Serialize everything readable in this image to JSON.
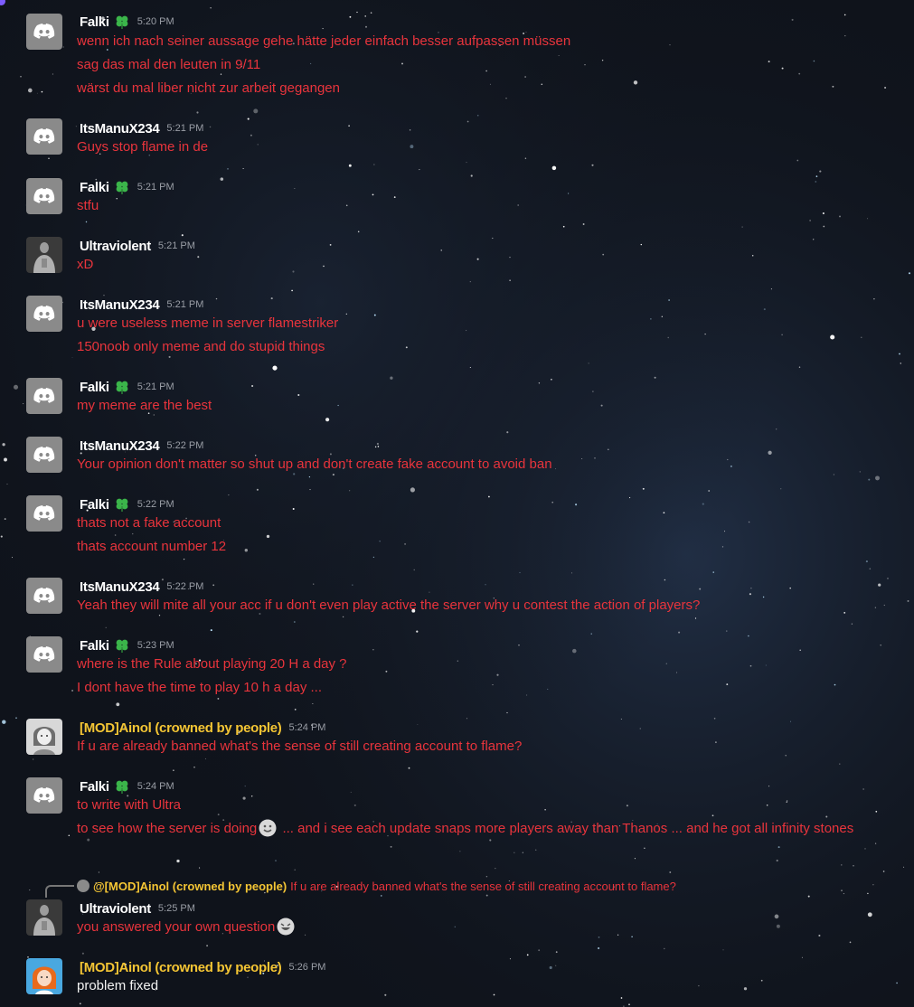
{
  "window": {
    "title": ""
  },
  "icons": {
    "default_avatar": "discord-logo-icon",
    "badge": "green-clover-badge-icon",
    "emoji_smile": "slight-smile-emoji-icon",
    "emoji_laugh": "rofl-emoji-icon"
  },
  "colors": {
    "message_text": "#e8343c",
    "username": "#ffffff",
    "mod_username": "#f4c534",
    "timestamp": "#9a9ea6",
    "badge": "#3bb54a",
    "avatar_bg": "#8a8a8a",
    "background": "#10141c"
  },
  "messages": [
    {
      "author": "Falki",
      "time": "5:20 PM",
      "lines": [
        "wenn ich nach seiner aussage gehe hätte jeder einfach besser aufpassen müssen",
        "sag das mal den leuten in 9/11",
        "wärst du mal liber nicht zur arbeit gegangen"
      ]
    },
    {
      "author": "ItsManuX234",
      "time": "5:21 PM",
      "lines": [
        "Guys stop flame in de"
      ]
    },
    {
      "author": "Falki",
      "time": "5:21 PM",
      "lines": [
        "stfu"
      ]
    },
    {
      "author": "Ultraviolent",
      "time": "5:21 PM",
      "lines": [
        "xD"
      ]
    },
    {
      "author": "ItsManuX234",
      "time": "5:21 PM",
      "lines": [
        "u were useless meme in server flamestriker",
        "150noob only meme and do stupid things"
      ]
    },
    {
      "author": "Falki",
      "time": "5:21 PM",
      "lines": [
        "my meme are the best"
      ]
    },
    {
      "author": "ItsManuX234",
      "time": "5:22 PM",
      "lines": [
        "Your opinion don't matter so shut up and don't create fake account to avoid ban"
      ]
    },
    {
      "author": "Falki",
      "time": "5:22 PM",
      "lines": [
        "thats not a fake account",
        "thats account number 12"
      ]
    },
    {
      "author": "ItsManuX234",
      "time": "5:22 PM",
      "lines": [
        "Yeah they will mite all your acc if u don't even play active the server why u contest the action of players?"
      ]
    },
    {
      "author": "Falki",
      "time": "5:23 PM",
      "lines": [
        "where is the Rule about playing 20 H a day ?",
        "I dont have the time to play 10 h a day ..."
      ]
    },
    {
      "author": "[MOD]Ainol (crowned by people)",
      "time": "5:24 PM",
      "lines": [
        "If u are already banned what's the sense of still creating account to flame?"
      ]
    },
    {
      "author": "Falki",
      "time": "5:24 PM",
      "lines": [
        "to write with Ultra",
        "to see how the server is doing",
        " ... and i see each update snaps more players away than Thanos ... and he got all infinity stones"
      ]
    },
    {
      "author": "Ultraviolent",
      "time": "5:25 PM",
      "lines": [
        "you answered your own question"
      ],
      "reply": {
        "author": "@[MOD]Ainol (crowned by people)",
        "text": "If u are already banned what's the sense of still creating account to flame?"
      }
    },
    {
      "author": "[MOD]Ainol (crowned by people)",
      "time": "5:26 PM",
      "lines": [
        "problem fixed"
      ]
    }
  ]
}
